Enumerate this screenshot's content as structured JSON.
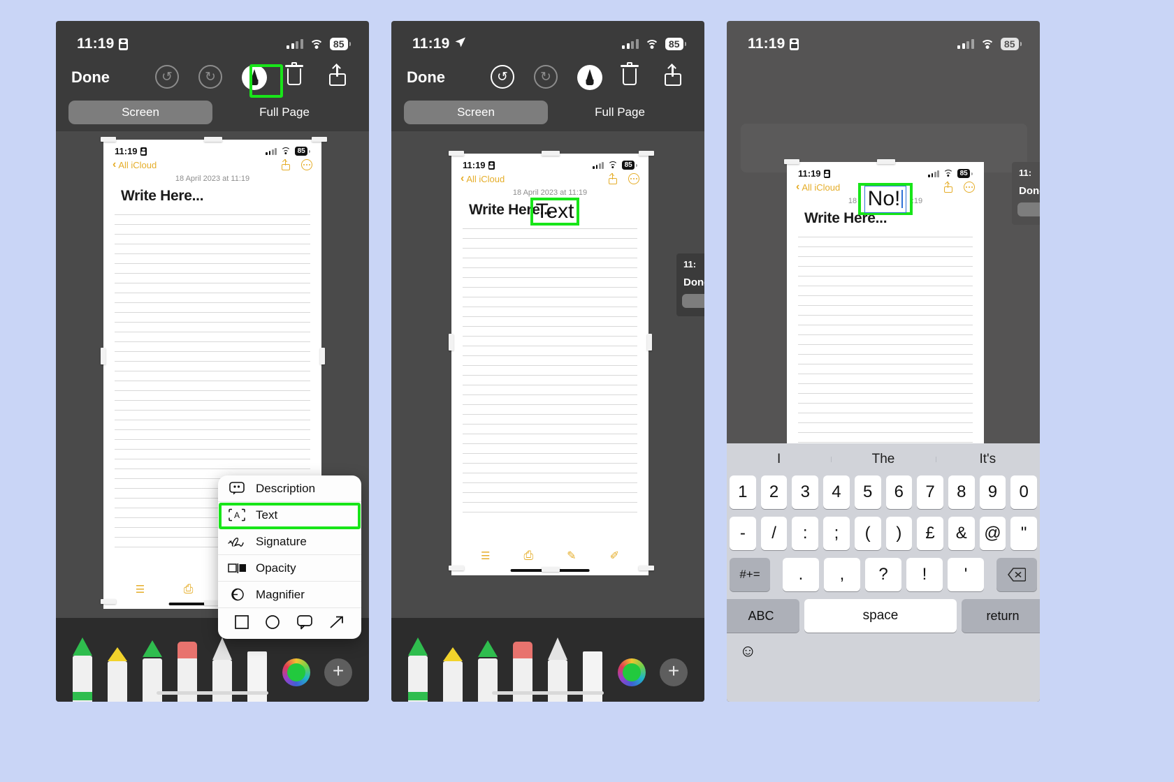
{
  "meta": {
    "background_color": "#c9d5f6",
    "accent_green": "#18e519",
    "notes_yellow": "#e5ad29",
    "shell_dark": "#3b3b3b"
  },
  "panels": [
    {
      "id": "panel-1",
      "status_bar": {
        "time": "11:19",
        "left_icon": "id-card-icon",
        "battery": "85",
        "cellular_icon": "cellular-bars-icon",
        "wifi_icon": "wifi-icon"
      },
      "markup_toolbar": {
        "done_label": "Done",
        "undo_icon": "undo-icon",
        "redo_icon": "redo-icon",
        "markup_pen_icon": "markup-pen-icon",
        "trash_icon": "trash-icon",
        "share_icon": "share-icon",
        "highlighted_tool": "markup-pen-icon"
      },
      "segmented": {
        "options": [
          "Screen",
          "Full Page"
        ],
        "selected": "Screen"
      },
      "note": {
        "status_time": "11:19",
        "battery": "85",
        "back_label": "All iCloud",
        "date": "18 April 2023 at 11:19",
        "title": "Write Here..."
      },
      "context_menu": {
        "items": [
          {
            "label": "Description",
            "icon": "description-bubble-icon",
            "highlighted": false
          },
          {
            "label": "Text",
            "icon": "text-box-icon",
            "highlighted": true
          },
          {
            "label": "Signature",
            "icon": "signature-icon",
            "highlighted": false
          },
          {
            "label": "Opacity",
            "icon": "opacity-icon",
            "highlighted": false
          },
          {
            "label": "Magnifier",
            "icon": "magnifier-icon",
            "highlighted": false
          }
        ],
        "shapes": [
          "square-icon",
          "circle-icon",
          "speech-bubble-icon",
          "arrow-icon"
        ]
      },
      "pen_tray": {
        "tools": [
          "pen-tool",
          "highlighter-tool",
          "marker-tool",
          "eraser-tool",
          "lasso-tool",
          "ruler-tool"
        ],
        "color_wheel_icon": "color-wheel-icon",
        "add_button_icon": "plus-icon"
      }
    },
    {
      "id": "panel-2",
      "status_bar": {
        "time": "11:19",
        "left_icon": "location-arrow-icon",
        "battery": "85"
      },
      "markup_toolbar": {
        "done_label": "Done",
        "undo_icon": "undo-icon",
        "redo_icon": "redo-icon",
        "markup_pen_icon": "markup-pen-icon",
        "trash_icon": "trash-icon",
        "share_icon": "share-icon"
      },
      "segmented": {
        "options": [
          "Screen",
          "Full Page"
        ],
        "selected": "Screen"
      },
      "note": {
        "status_time": "11:19",
        "battery": "85",
        "back_label": "All iCloud",
        "date": "18 April 2023 at 11:19",
        "title": "Write Here..."
      },
      "text_annotation": {
        "value": "Text",
        "highlighted": true
      },
      "page_dots": {
        "count": 2,
        "active_index": 0
      },
      "pen_tray": {
        "tools": [
          "pen-tool",
          "highlighter-tool",
          "marker-tool",
          "eraser-tool",
          "lasso-tool",
          "ruler-tool"
        ],
        "color_wheel_icon": "color-wheel-icon",
        "add_button_icon": "plus-icon"
      }
    },
    {
      "id": "panel-3",
      "status_bar": {
        "time": "11:19",
        "left_icon": "id-card-icon",
        "battery": "85"
      },
      "note": {
        "status_time": "11:19",
        "battery": "85",
        "back_label": "All iCloud",
        "date": "18 April 2023 at 11:19",
        "title": "Write Here..."
      },
      "text_annotation": {
        "value": "No!",
        "highlighted": true,
        "editing": true
      },
      "background_card": {
        "time": "11:",
        "done_label": "Done"
      },
      "keyboard": {
        "predictions": [
          "I",
          "The",
          "It's"
        ],
        "rows": [
          [
            "1",
            "2",
            "3",
            "4",
            "5",
            "6",
            "7",
            "8",
            "9",
            "0"
          ],
          [
            "-",
            "/",
            ":",
            ";",
            "(",
            ")",
            "£",
            "&",
            "@",
            "\""
          ],
          [
            "#+=",
            ".",
            ",",
            "?",
            "!",
            "'",
            "delete-icon"
          ],
          [
            "ABC",
            "space",
            "return"
          ]
        ],
        "emoji_icon": "emoji-smiley-icon"
      }
    }
  ]
}
